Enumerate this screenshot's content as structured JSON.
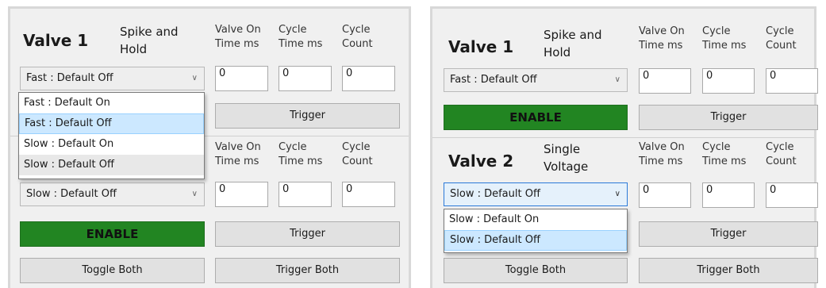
{
  "left": {
    "valve1": {
      "title": "Valve 1",
      "mode": [
        "Spike and",
        "Hold"
      ],
      "col_valve_on": [
        "Valve On",
        "Time ms"
      ],
      "col_cycle_time": [
        "Cycle",
        "Time ms"
      ],
      "col_cycle_count": [
        "Cycle",
        "Count"
      ],
      "selected": "Fast : Default Off",
      "valve_on_value": "0",
      "cycle_time_value": "0",
      "cycle_count_value": "0",
      "trigger_label": "Trigger",
      "dropdown_options": [
        "Fast : Default On",
        "Fast : Default Off",
        "Slow : Default On",
        "Slow : Default Off"
      ],
      "dropdown_selected_index": 1
    },
    "valve2": {
      "col_valve_on": [
        "Valve On",
        "Time ms"
      ],
      "col_cycle_time": [
        "Cycle",
        "Time ms"
      ],
      "col_cycle_count": [
        "Cycle",
        "Count"
      ],
      "selected": "Slow : Default Off",
      "valve_on_value": "0",
      "cycle_time_value": "0",
      "cycle_count_value": "0",
      "enable_label": "ENABLE",
      "trigger_label": "Trigger"
    },
    "toggle_both_label": "Toggle Both",
    "trigger_both_label": "Trigger Both"
  },
  "right": {
    "valve1": {
      "title": "Valve 1",
      "mode": [
        "Spike and",
        "Hold"
      ],
      "col_valve_on": [
        "Valve On",
        "Time ms"
      ],
      "col_cycle_time": [
        "Cycle",
        "Time ms"
      ],
      "col_cycle_count": [
        "Cycle",
        "Count"
      ],
      "selected": "Fast : Default Off",
      "valve_on_value": "0",
      "cycle_time_value": "0",
      "cycle_count_value": "0",
      "enable_label": "ENABLE",
      "trigger_label": "Trigger"
    },
    "valve2": {
      "title": "Valve 2",
      "mode": [
        "Single",
        "Voltage"
      ],
      "col_valve_on": [
        "Valve On",
        "Time ms"
      ],
      "col_cycle_time": [
        "Cycle",
        "Time ms"
      ],
      "col_cycle_count": [
        "Cycle",
        "Count"
      ],
      "selected": "Slow : Default Off",
      "valve_on_value": "0",
      "cycle_time_value": "0",
      "cycle_count_value": "0",
      "trigger_label": "Trigger",
      "dropdown_options": [
        "Slow : Default On",
        "Slow : Default Off"
      ],
      "dropdown_selected_index": 1
    },
    "toggle_both_label": "Toggle Both",
    "trigger_both_label": "Trigger Both"
  },
  "colors": {
    "enable_green": "#228522",
    "panel_bg": "#f0f0f0",
    "selection_blue": "#cce8ff",
    "focus_border": "#2b79d8"
  },
  "icons": {
    "combo_arrow": "chevron-down-icon"
  }
}
